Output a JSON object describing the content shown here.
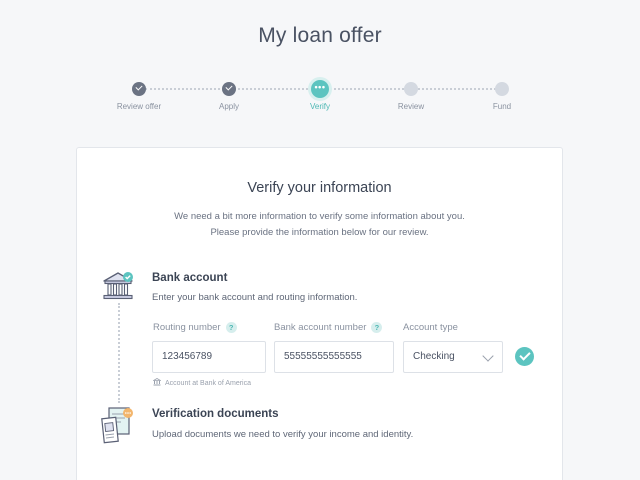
{
  "page": {
    "title": "My loan offer"
  },
  "stepper": {
    "steps": [
      {
        "label": "Review offer",
        "state": "done"
      },
      {
        "label": "Apply",
        "state": "done"
      },
      {
        "label": "Verify",
        "state": "active"
      },
      {
        "label": "Review",
        "state": "pending"
      },
      {
        "label": "Fund",
        "state": "pending"
      }
    ]
  },
  "card": {
    "title": "Verify your information",
    "intro_line1": "We need a bit more information to verify some information about you.",
    "intro_line2": "Please provide the information below for our review."
  },
  "bank_section": {
    "title": "Bank account",
    "description": "Enter your bank account and routing information.",
    "routing_label": "Routing number",
    "routing_value": "123456789",
    "account_label": "Bank account number",
    "account_value": "55555555555555",
    "type_label": "Account type",
    "type_value": "Checking",
    "bank_hint": "Account at Bank of America",
    "help_glyph": "?"
  },
  "docs_section": {
    "title": "Verification documents",
    "description": "Upload documents we need to verify your income and identity."
  },
  "colors": {
    "accent": "#5cc4c0",
    "done": "#6b7383",
    "pending": "#d4d9e1"
  },
  "icons": [
    "check-icon",
    "more-dots-icon",
    "bank-icon",
    "documents-icon",
    "help-icon",
    "chevron-down-icon"
  ]
}
